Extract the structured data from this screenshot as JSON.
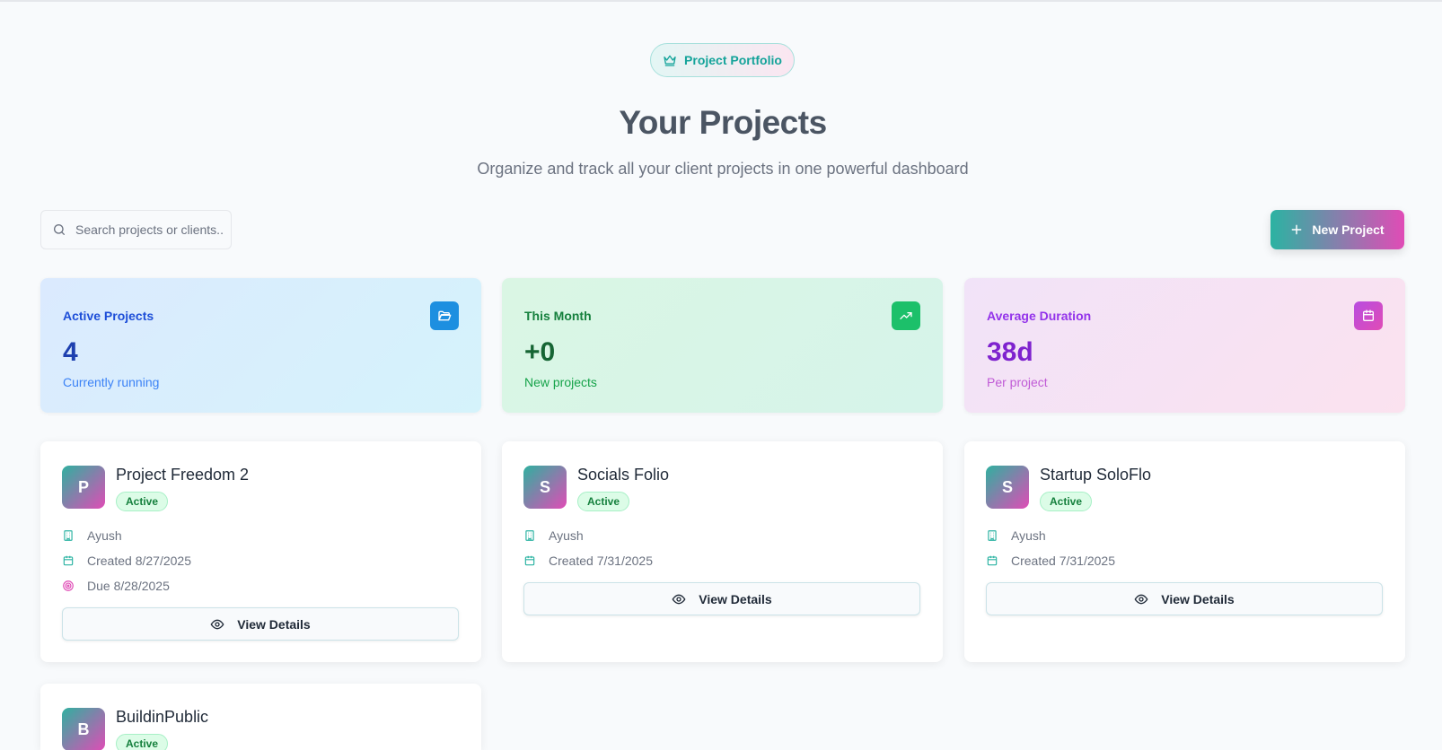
{
  "header": {
    "pill_label": "Project Portfolio",
    "title": "Your Projects",
    "subtitle": "Organize and track all your client projects in one powerful dashboard"
  },
  "toolbar": {
    "search_placeholder": "Search projects or clients...",
    "new_project_label": "New Project"
  },
  "stats": [
    {
      "label": "Active Projects",
      "value": "4",
      "sub": "Currently running",
      "icon": "folder-open-icon"
    },
    {
      "label": "This Month",
      "value": "+0",
      "sub": "New projects",
      "icon": "trending-up-icon"
    },
    {
      "label": "Average Duration",
      "value": "38d",
      "sub": "Per project",
      "icon": "calendar-icon"
    }
  ],
  "projects": [
    {
      "initial": "P",
      "name": "Project Freedom 2",
      "status": "Active",
      "client": "Ayush",
      "created": "Created 8/27/2025",
      "due": "Due 8/28/2025",
      "action": "View Details"
    },
    {
      "initial": "S",
      "name": "Socials Folio",
      "status": "Active",
      "client": "Ayush",
      "created": "Created 7/31/2025",
      "action": "View Details"
    },
    {
      "initial": "S",
      "name": "Startup SoloFlo",
      "status": "Active",
      "client": "Ayush",
      "created": "Created 7/31/2025",
      "action": "View Details"
    },
    {
      "initial": "B",
      "name": "BuildinPublic",
      "status": "Active"
    }
  ],
  "colors": {
    "accent_teal": "#2bb3a2",
    "accent_pink": "#e04cb6",
    "active_badge": "#15803d"
  }
}
